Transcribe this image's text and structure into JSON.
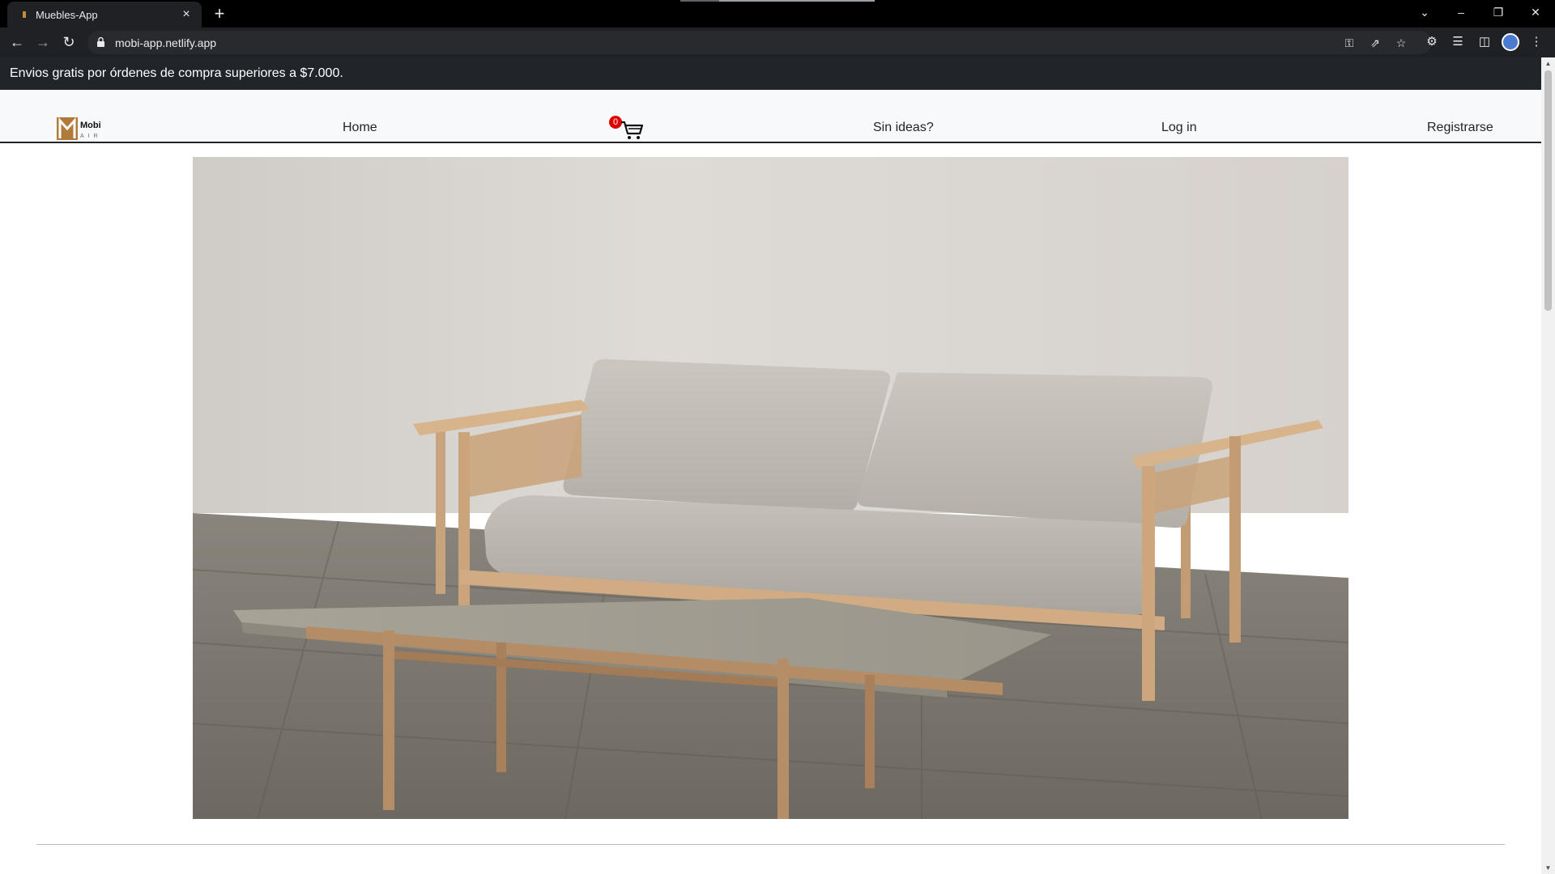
{
  "browser": {
    "tab_title": "Muebles-App",
    "url": "mobi-app.netlify.app",
    "new_tab_symbol": "+",
    "close_symbol": "×"
  },
  "promo": {
    "text": "Envios gratis por órdenes de compra superiores a $7.000."
  },
  "navbar": {
    "logo_text": "Mobi",
    "logo_subtext": "AIR",
    "links": [
      "Home",
      "Sin ideas?",
      "Log in",
      "Registrarse"
    ],
    "cart_count": "0"
  },
  "hero": {
    "alt": "Sofá de madera con cojines grises y mesa de centro de piedra"
  },
  "colors": {
    "promo_bg": "#212529",
    "navbar_bg": "#f8f9fa",
    "cart_badge": "#e00000",
    "browser_chrome": "#202124"
  },
  "icons": {
    "back": "arrow-left-icon",
    "forward": "arrow-right-icon",
    "reload": "reload-icon",
    "lock": "lock-icon",
    "key": "key-icon",
    "share": "share-icon",
    "bookmark": "star-icon",
    "extensions": "puzzle-icon",
    "reading_list": "reading-list-icon",
    "side_panel": "side-panel-icon",
    "menu": "kebab-menu-icon",
    "cart": "shopping-cart-icon"
  }
}
